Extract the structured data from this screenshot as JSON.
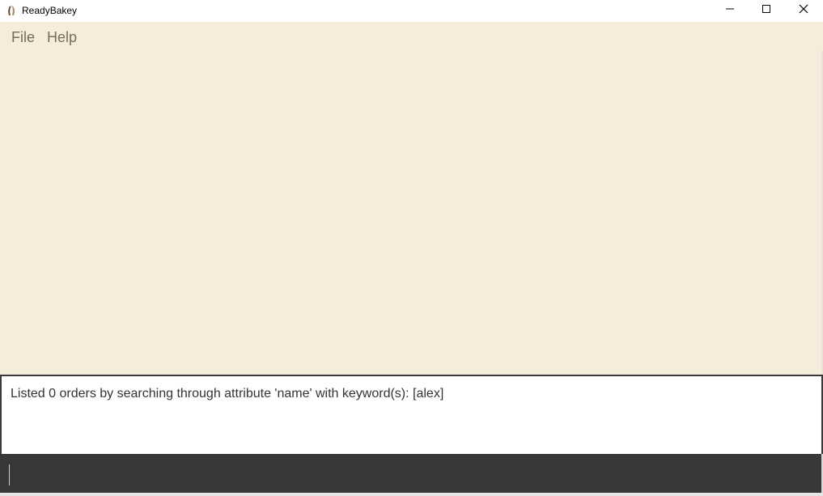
{
  "window": {
    "title": "ReadyBakey",
    "app_icon": "readybakey-app-icon",
    "controls": {
      "minimize_icon": "minimize-icon",
      "maximize_icon": "maximize-icon",
      "close_icon": "close-icon"
    }
  },
  "menubar": {
    "items": [
      {
        "label": "File"
      },
      {
        "label": "Help"
      }
    ]
  },
  "result_display": {
    "text": "Listed 0 orders by searching through attribute 'name' with keyword(s): [alex]"
  },
  "command_box": {
    "value": "",
    "placeholder": ""
  },
  "colors": {
    "background": "#f5ecdc",
    "menu_text": "#7a6a57",
    "command_bar": "#383838",
    "result_border": "#3a3a3a"
  }
}
